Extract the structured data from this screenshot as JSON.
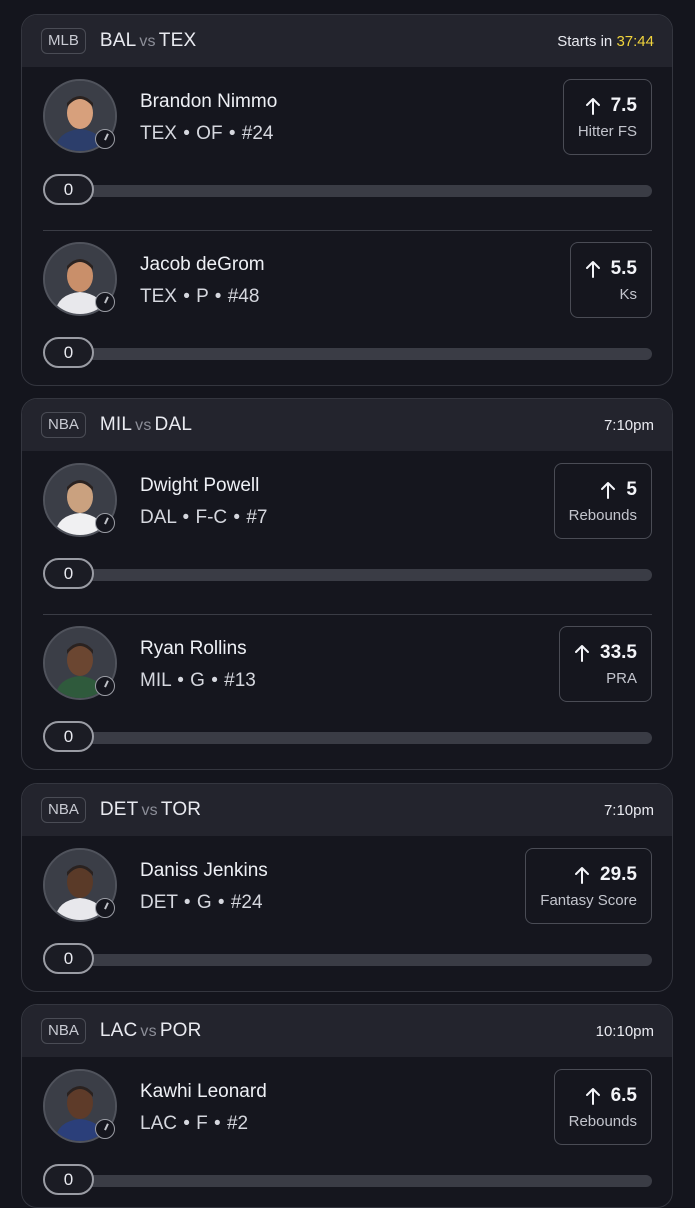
{
  "games": [
    {
      "league": "MLB",
      "home": "BAL",
      "vs": "vs",
      "away": "TEX",
      "time_prefix": "Starts in",
      "countdown": "37:44",
      "time": "",
      "players": [
        {
          "name": "Brandon Nimmo",
          "meta": "TEX • OF • #24",
          "line": "7.5",
          "stat": "Hitter FS",
          "progress": "0",
          "avatar_icon": "player-headshot",
          "skin": "#d7a07c",
          "jersey": "#2c3e6b"
        },
        {
          "name": "Jacob deGrom",
          "meta": "TEX • P • #48",
          "line": "5.5",
          "stat": "Ks",
          "progress": "0",
          "avatar_icon": "player-headshot",
          "skin": "#c98f6a",
          "jersey": "#e8e8ec"
        }
      ]
    },
    {
      "league": "NBA",
      "home": "MIL",
      "vs": "vs",
      "away": "DAL",
      "time_prefix": "",
      "countdown": "",
      "time": "7:10pm",
      "players": [
        {
          "name": "Dwight Powell",
          "meta": "DAL • F-C • #7",
          "line": "5",
          "stat": "Rebounds",
          "progress": "0",
          "avatar_icon": "player-headshot",
          "skin": "#caa17f",
          "jersey": "#f0f0f2"
        },
        {
          "name": "Ryan Rollins",
          "meta": "MIL • G • #13",
          "line": "33.5",
          "stat": "PRA",
          "progress": "0",
          "avatar_icon": "player-headshot",
          "skin": "#6b4631",
          "jersey": "#2f5a3c"
        }
      ]
    },
    {
      "league": "NBA",
      "home": "DET",
      "vs": "vs",
      "away": "TOR",
      "time_prefix": "",
      "countdown": "",
      "time": "7:10pm",
      "players": [
        {
          "name": "Daniss Jenkins",
          "meta": "DET • G • #24",
          "line": "29.5",
          "stat": "Fantasy Score",
          "progress": "0",
          "avatar_icon": "player-headshot",
          "skin": "#5a3a28",
          "jersey": "#e8e8ec"
        }
      ]
    },
    {
      "league": "NBA",
      "home": "LAC",
      "vs": "vs",
      "away": "POR",
      "time_prefix": "",
      "countdown": "",
      "time": "10:10pm",
      "players": [
        {
          "name": "Kawhi Leonard",
          "meta": "LAC • F • #2",
          "line": "6.5",
          "stat": "Rebounds",
          "progress": "0",
          "avatar_icon": "player-headshot",
          "skin": "#5e3b29",
          "jersey": "#2b3f7a"
        }
      ]
    }
  ],
  "icons": {
    "arrow": "arrow-up-icon",
    "clock": "clock-icon"
  }
}
